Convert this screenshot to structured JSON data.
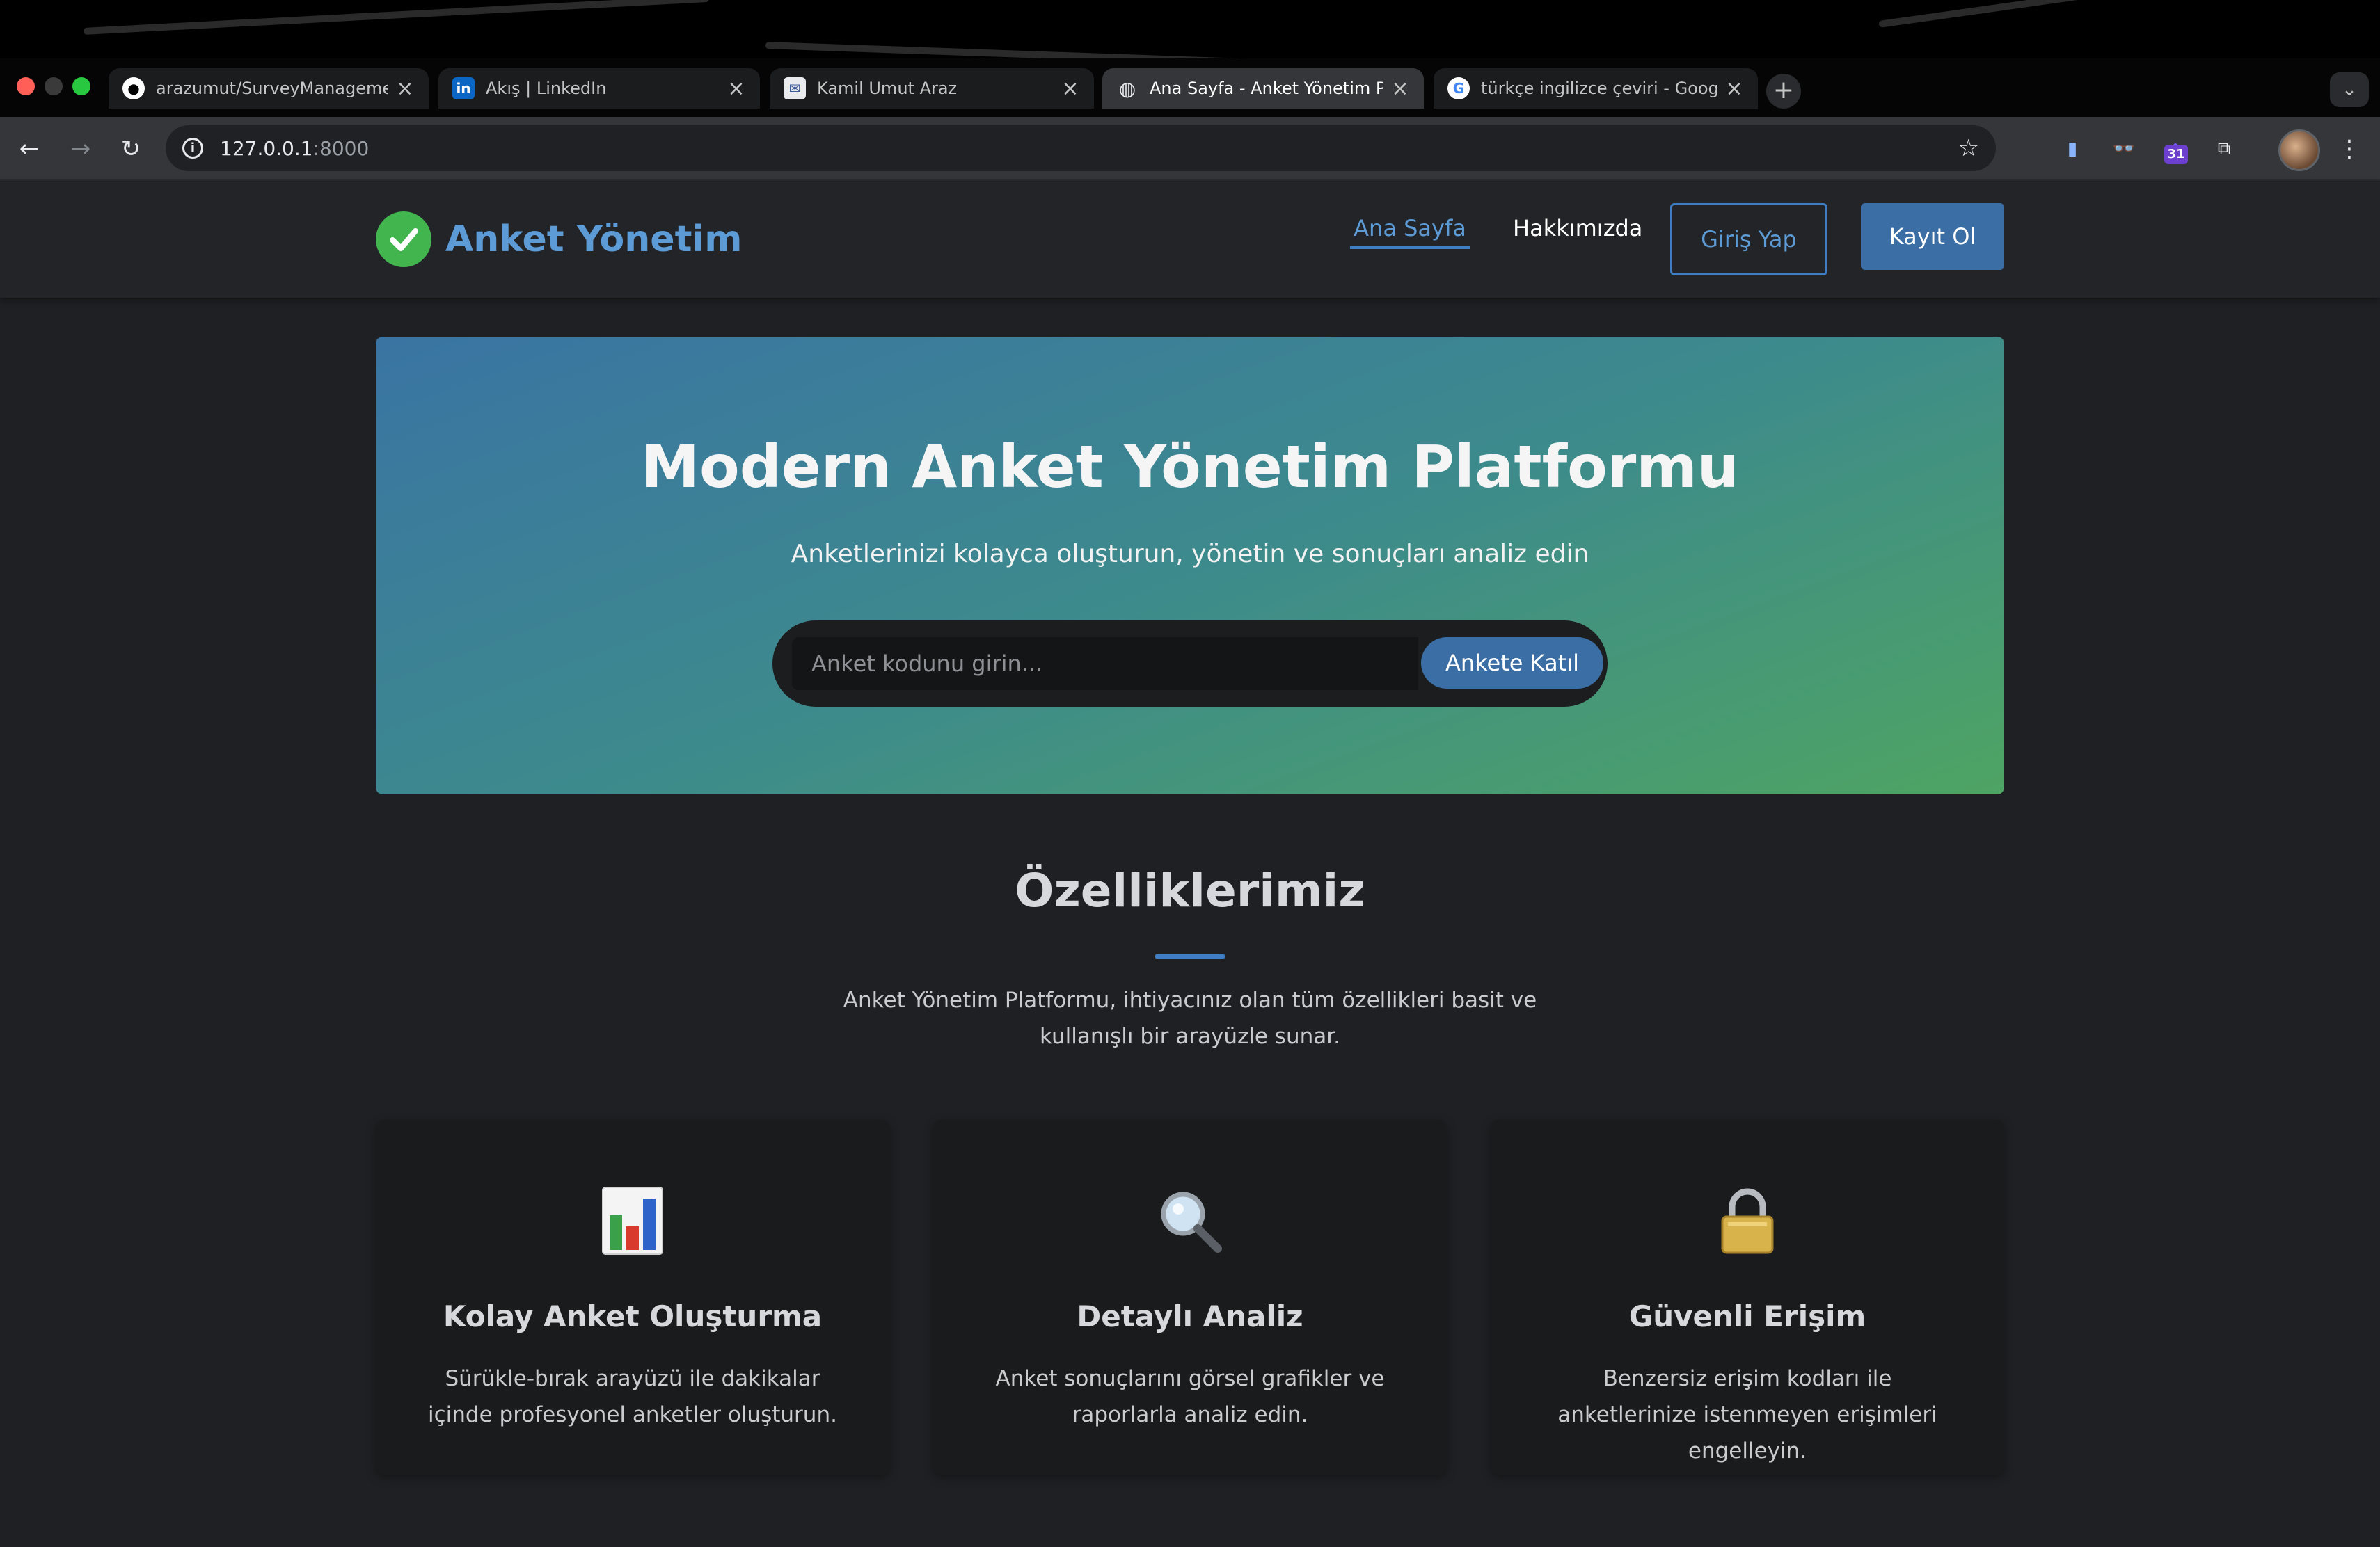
{
  "browser": {
    "tabs": [
      {
        "title": "arazumut/SurveyManagement",
        "favicon": "github-icon",
        "active": false
      },
      {
        "title": "Akış | LinkedIn",
        "favicon": "linkedin-icon",
        "active": false
      },
      {
        "title": "Kamil Umut Araz",
        "favicon": "mail-icon",
        "active": false
      },
      {
        "title": "Ana Sayfa - Anket Yönetim Platformu",
        "favicon": "globe-icon",
        "active": true
      },
      {
        "title": "türkçe ingilizce çeviri - Google",
        "favicon": "google-icon",
        "active": false
      }
    ],
    "new_tab": "+",
    "tab_menu": "⌄",
    "url_host": "127.0.0.1",
    "url_port": ":8000",
    "extension_badge": "31"
  },
  "site": {
    "logo_text": "Anket Yönetim",
    "nav": {
      "home": "Ana Sayfa",
      "about": "Hakkımızda",
      "login": "Giriş Yap",
      "register": "Kayıt Ol"
    },
    "hero": {
      "title": "Modern Anket Yönetim Platformu",
      "subtitle": "Anketlerinizi kolayca oluşturun, yönetin ve sonuçları analiz edin",
      "input_placeholder": "Anket kodunu girin...",
      "button": "Ankete Katıl"
    },
    "features": {
      "title": "Özelliklerimiz",
      "description": "Anket Yönetim Platformu, ihtiyacınız olan tüm özellikleri basit ve kullanışlı bir arayüzle sunar.",
      "cards": [
        {
          "icon": "bar-chart-icon",
          "title": "Kolay Anket Oluşturma",
          "text": "Sürükle-bırak arayüzü ile dakikalar içinde profesyonel anketler oluşturun."
        },
        {
          "icon": "magnifier-icon",
          "title": "Detaylı Analiz",
          "text": "Anket sonuçlarını görsel grafikler ve raporlarla analiz edin."
        },
        {
          "icon": "lock-icon",
          "title": "Güvenli Erişim",
          "text": "Benzersiz erişim kodları ile anketlerinize istenmeyen erişimleri engelleyin."
        }
      ]
    }
  },
  "colors": {
    "accent": "#3f7ec4",
    "brand_green": "#43b54f",
    "hero_gradient_start": "#3a74a3",
    "hero_gradient_end": "#4ea463",
    "page_background": "#1e2023"
  }
}
